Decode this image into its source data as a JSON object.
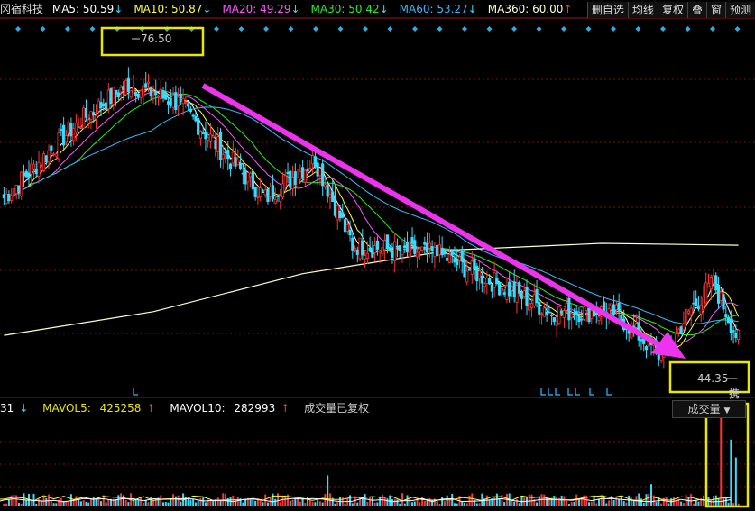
{
  "header": {
    "stock_name": "冈宿科技",
    "ma": [
      {
        "label": "MA5:",
        "value": "50.59",
        "arrow": "↓",
        "color": "#ffffff",
        "arrow_color": "#33ddff"
      },
      {
        "label": "MA10:",
        "value": "50.87",
        "arrow": "↓",
        "color": "#ffff33",
        "arrow_color": "#33ddff"
      },
      {
        "label": "MA20:",
        "value": "49.29",
        "arrow": "↓",
        "color": "#ff55ff",
        "arrow_color": "#33ddff"
      },
      {
        "label": "MA30:",
        "value": "50.42",
        "arrow": "↓",
        "color": "#22ee22",
        "arrow_color": "#33ddff"
      },
      {
        "label": "MA60:",
        "value": "53.27",
        "arrow": "↓",
        "color": "#33bbff",
        "arrow_color": "#33ddff"
      },
      {
        "label": "MA360:",
        "value": "60.00",
        "arrow": "↑",
        "color": "#ffffcc",
        "arrow_color": "#ff3333"
      }
    ]
  },
  "toolbar": {
    "buttons": [
      "删自选",
      "均线",
      "复权",
      "叠",
      "窗",
      "预测"
    ]
  },
  "volume_header": {
    "prefix": "31",
    "prefix_arrow": "↓",
    "mavol5_label": "MAVOL5:",
    "mavol5_value": "425258",
    "mavol5_arrow": "↑",
    "mavol10_label": "MAVOL10:",
    "mavol10_value": "282993",
    "mavol10_arrow": "↑",
    "note": "成交量已复权",
    "selector": "成交量"
  },
  "annotations": {
    "high_price": "76.50",
    "low_price": "44.35",
    "corner_text": "携"
  },
  "colors": {
    "up": "#ff3333",
    "down": "#33ddff",
    "ma5": "#ffffff",
    "ma10": "#ffff33",
    "ma20": "#ff55ff",
    "ma30": "#22ee22",
    "ma60": "#33bbff",
    "ma360": "#ffffcc",
    "trend_arrow": "#ee33ee",
    "highlight_box": "#e8e800",
    "grid": "#7a1010"
  },
  "chart_data": {
    "type": "candlestick",
    "ylim": [
      42,
      80
    ],
    "high": 76.5,
    "low": 44.35,
    "segments": [
      {
        "from": 0,
        "to": 30,
        "start": 62,
        "end": 70
      },
      {
        "from": 30,
        "to": 50,
        "start": 70,
        "end": 74
      },
      {
        "from": 50,
        "to": 70,
        "start": 74,
        "end": 72
      },
      {
        "from": 70,
        "to": 105,
        "start": 72,
        "end": 62
      },
      {
        "from": 105,
        "to": 125,
        "start": 62,
        "end": 66
      },
      {
        "from": 125,
        "to": 140,
        "start": 66,
        "end": 57
      },
      {
        "from": 140,
        "to": 175,
        "start": 57,
        "end": 56
      },
      {
        "from": 175,
        "to": 220,
        "start": 56,
        "end": 50
      },
      {
        "from": 220,
        "to": 245,
        "start": 50,
        "end": 50
      },
      {
        "from": 245,
        "to": 265,
        "start": 50,
        "end": 45
      },
      {
        "from": 265,
        "to": 275,
        "start": 45,
        "end": 50
      },
      {
        "from": 275,
        "to": 285,
        "start": 50,
        "end": 53
      },
      {
        "from": 285,
        "to": 295,
        "start": 53,
        "end": 47
      }
    ],
    "ma360_points": [
      [
        0,
        47.5
      ],
      [
        60,
        50
      ],
      [
        120,
        54
      ],
      [
        180,
        56.5
      ],
      [
        240,
        57.2
      ],
      [
        295,
        57.0
      ]
    ],
    "volume_spikes": [
      [
        130,
        0.35
      ],
      [
        260,
        0.25
      ],
      [
        288,
        1.0
      ],
      [
        292,
        0.75
      ],
      [
        294,
        0.55
      ]
    ]
  }
}
